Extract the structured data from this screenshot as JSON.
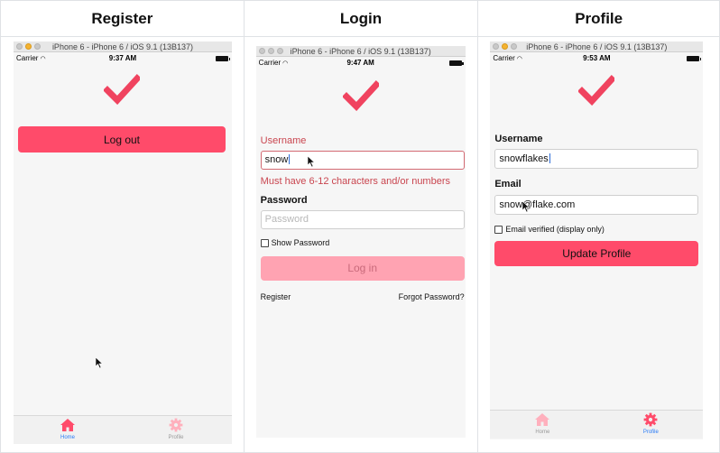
{
  "headers": [
    "Register",
    "Login",
    "Profile"
  ],
  "colors": {
    "accent": "#ff4b6a",
    "accent_disabled": "#ffa3b2",
    "error": "#c9454f",
    "tab_active": "#2a7cf6"
  },
  "screens": [
    {
      "window_title": "iPhone 6 - iPhone 6 / iOS 9.1 (13B137)",
      "carrier": "Carrier",
      "time": "9:37 AM",
      "logout_label": "Log out",
      "tabs": [
        {
          "label": "Home",
          "icon": "home-icon",
          "active": true
        },
        {
          "label": "Profile",
          "icon": "gear-icon",
          "active": false
        }
      ]
    },
    {
      "window_title": "iPhone 6 - iPhone 6 / iOS 9.1 (13B137)",
      "carrier": "Carrier",
      "time": "9:47 AM",
      "username_label": "Username",
      "username_value": "snow",
      "username_error": "Must have 6-12 characters and/or numbers",
      "password_label": "Password",
      "password_placeholder": "Password",
      "show_password_label": "Show Password",
      "login_label": "Log in",
      "register_link": "Register",
      "forgot_link": "Forgot Password?"
    },
    {
      "window_title": "iPhone 6 - iPhone 6 / iOS 9.1 (13B137)",
      "carrier": "Carrier",
      "time": "9:53 AM",
      "username_label": "Username",
      "username_value": "snowflakes",
      "email_label": "Email",
      "email_value": "snow@flake.com",
      "email_verified_label": "Email verified (display only)",
      "update_label": "Update Profile",
      "tabs": [
        {
          "label": "Home",
          "icon": "home-icon",
          "active": false
        },
        {
          "label": "Profile",
          "icon": "gear-icon",
          "active": true
        }
      ]
    }
  ]
}
